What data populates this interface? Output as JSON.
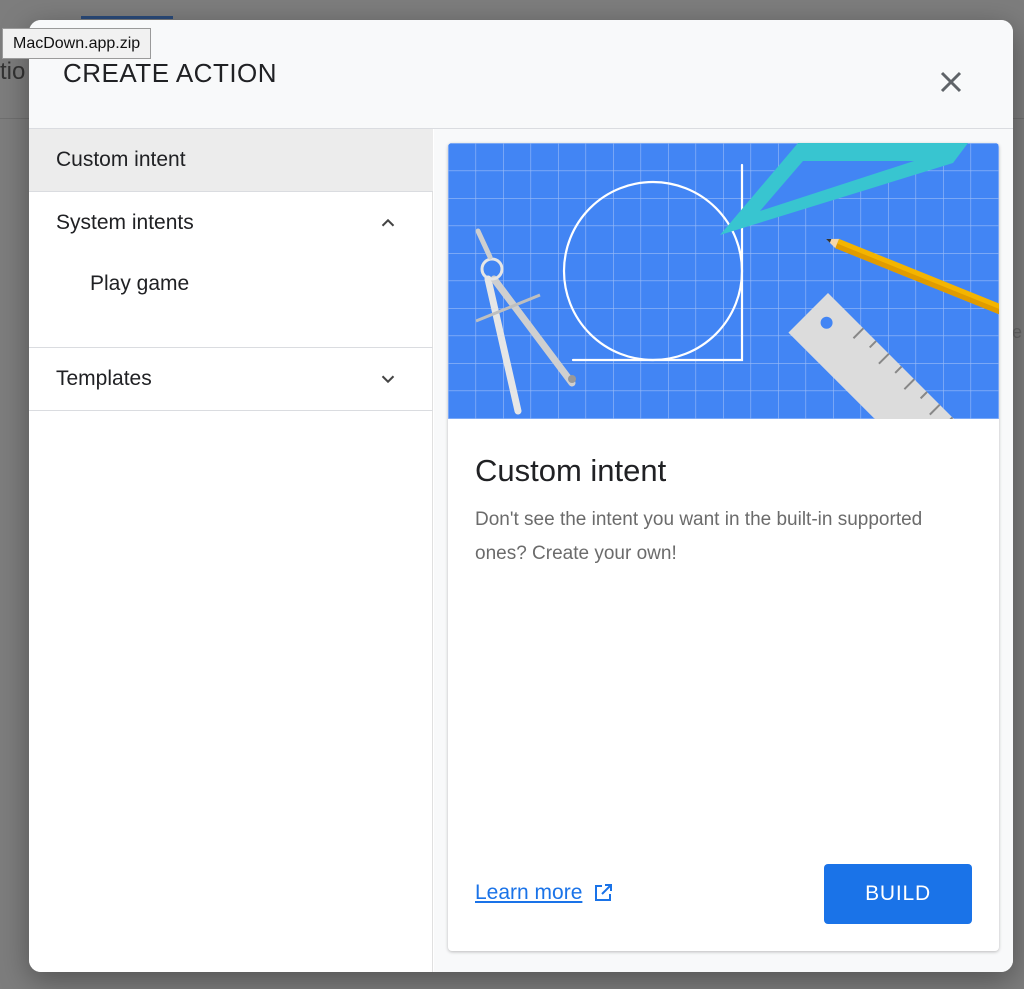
{
  "tooltip": {
    "text": "MacDown.app.zip"
  },
  "background": {
    "left_fragment": "tio",
    "right_fragment": "e"
  },
  "dialog": {
    "title": "CREATE ACTION",
    "close_icon": "close-icon"
  },
  "sidebar": {
    "items": [
      {
        "label": "Custom intent",
        "selected": true
      },
      {
        "label": "System intents",
        "expanded": true,
        "icon": "chevron-up-icon"
      },
      {
        "label": "Play game",
        "sub": true
      },
      {
        "label": "Templates",
        "expanded": false,
        "icon": "chevron-down-icon"
      }
    ]
  },
  "card": {
    "title": "Custom intent",
    "description": "Don't see the intent you want in the built-in supported ones? Create your own!",
    "learn_more": "Learn more",
    "build": "BUILD",
    "hero_color": "#4285f4"
  },
  "colors": {
    "accent": "#1a73e8"
  }
}
